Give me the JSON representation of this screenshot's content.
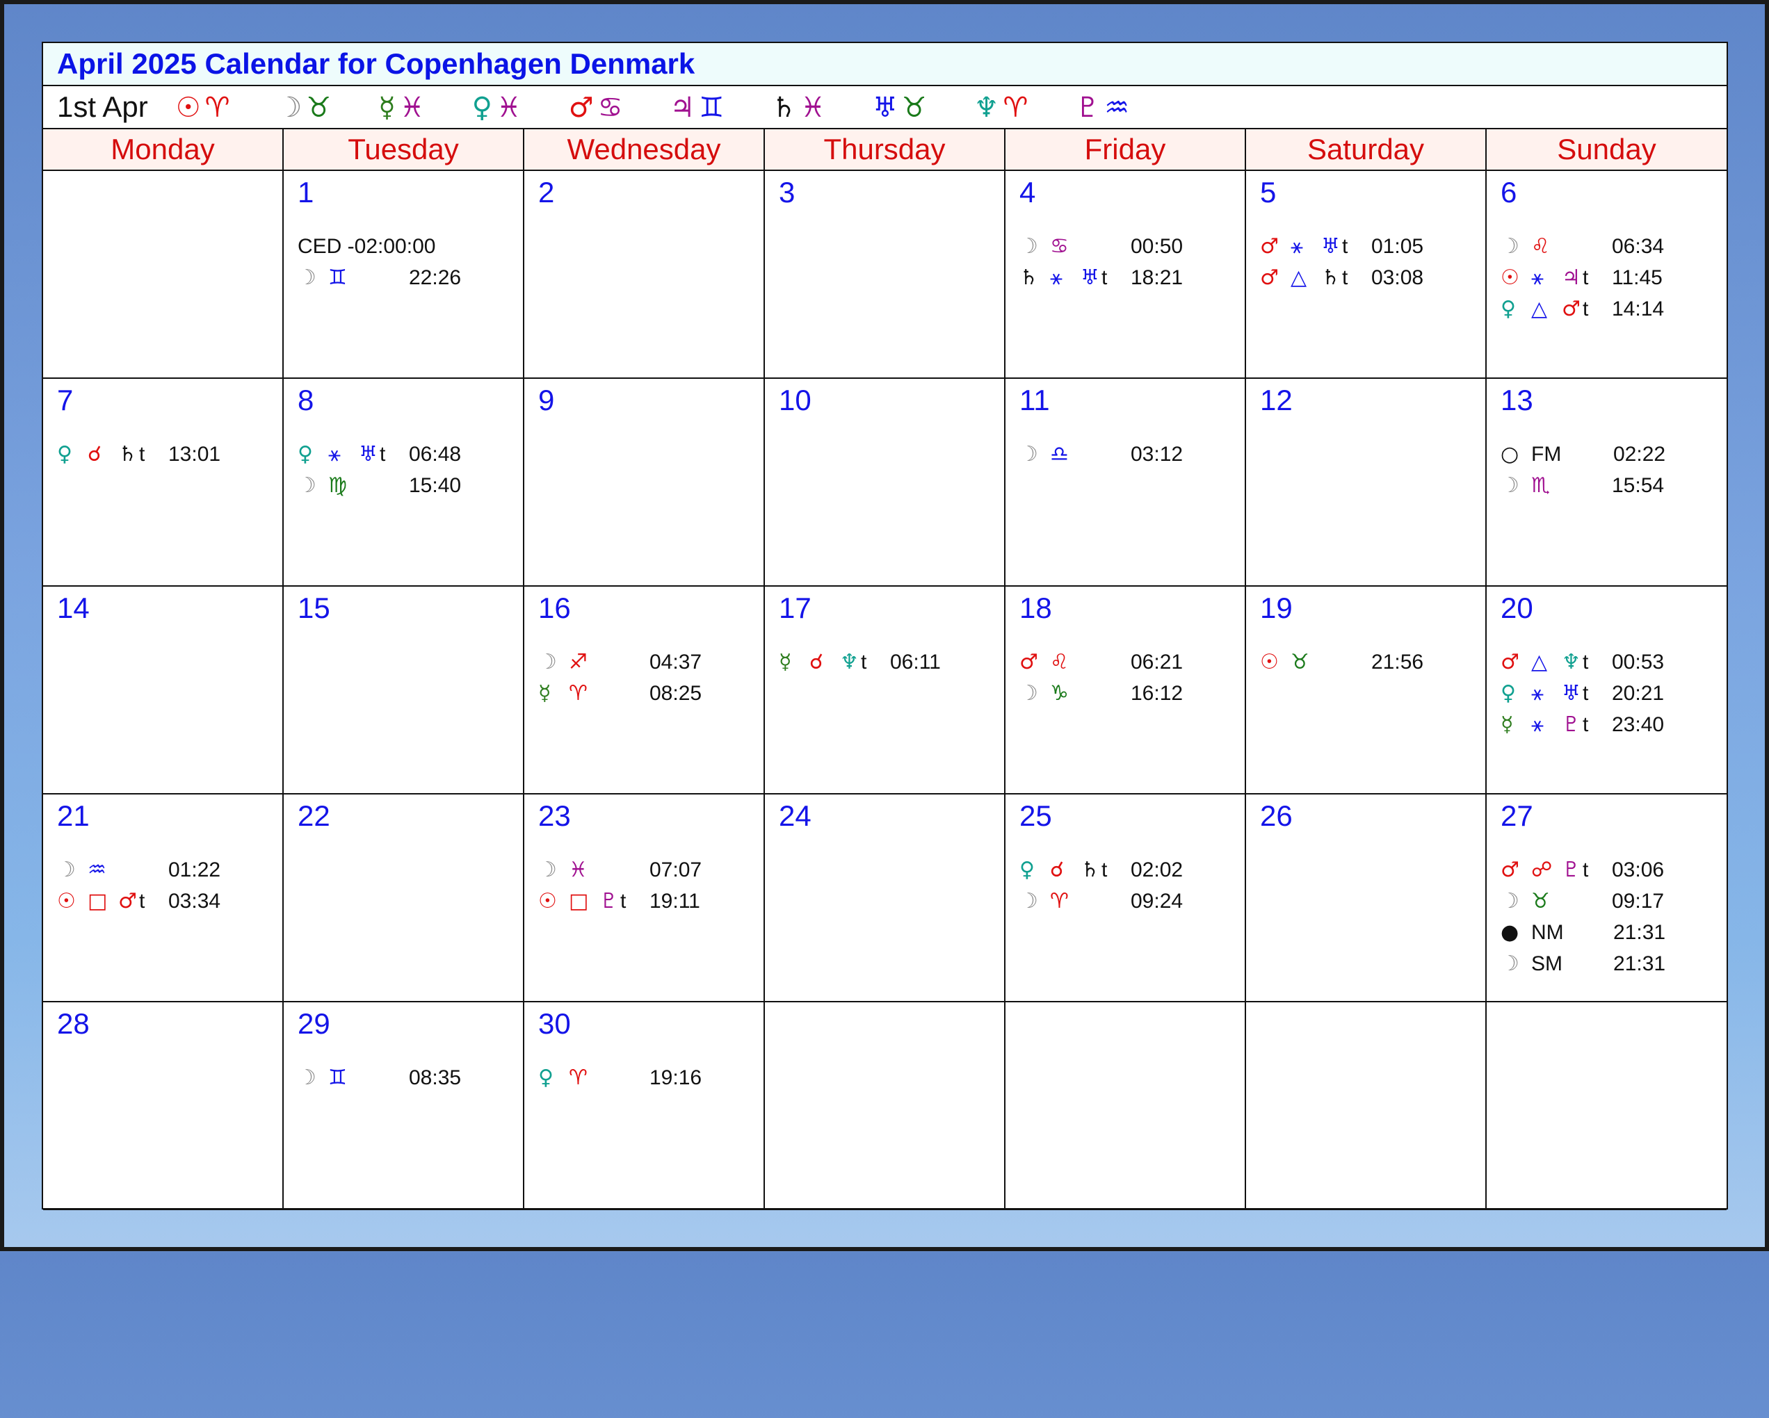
{
  "title": "April 2025 Calendar for Copenhagen Denmark",
  "planet_bar": {
    "date": "1st Apr",
    "items": [
      {
        "planet": "☉",
        "planet_color": "#e01010",
        "sign": "♈",
        "sign_color": "#e01010"
      },
      {
        "planet": "☽",
        "planet_color": "#888888",
        "sign": "♉",
        "sign_color": "#1a7a1a"
      },
      {
        "planet": "☿",
        "planet_color": "#2e7d1e",
        "sign": "♓",
        "sign_color": "#a01090"
      },
      {
        "planet": "♀",
        "planet_color": "#10a090",
        "sign": "♓",
        "sign_color": "#a01090"
      },
      {
        "planet": "♂",
        "planet_color": "#e01010",
        "sign": "♋",
        "sign_color": "#a01090"
      },
      {
        "planet": "♃",
        "planet_color": "#a01090",
        "sign": "♊",
        "sign_color": "#1414e8"
      },
      {
        "planet": "♄",
        "planet_color": "#111111",
        "sign": "♓",
        "sign_color": "#a01090"
      },
      {
        "planet": "♅",
        "planet_color": "#1414e8",
        "sign": "♉",
        "sign_color": "#1a7a1a"
      },
      {
        "planet": "♆",
        "planet_color": "#10a090",
        "sign": "♈",
        "sign_color": "#e01010"
      },
      {
        "planet": "♇",
        "planet_color": "#a01090",
        "sign": "♒",
        "sign_color": "#1414e8"
      }
    ]
  },
  "weekdays": [
    "Monday",
    "Tuesday",
    "Wednesday",
    "Thursday",
    "Friday",
    "Saturday",
    "Sunday"
  ],
  "colors": {
    "sun": "#e01010",
    "moon": "#888888",
    "mercury": "#2e7d1e",
    "venus": "#10a090",
    "mars": "#e01010",
    "jupiter": "#a01090",
    "saturn": "#111111",
    "uranus": "#1414e8",
    "neptune": "#10a090",
    "pluto": "#a01090",
    "aspect": "#1414e8",
    "square": "#e01010"
  },
  "days": [
    {
      "n": "",
      "events": []
    },
    {
      "n": "1",
      "events": [
        {
          "text": "CED -02:00:00"
        },
        {
          "g1": "☽",
          "c1": "#888888",
          "g2": "♊",
          "c2": "#1414e8",
          "time": "22:26"
        }
      ]
    },
    {
      "n": "2",
      "events": []
    },
    {
      "n": "3",
      "events": []
    },
    {
      "n": "4",
      "events": [
        {
          "g1": "☽",
          "c1": "#888888",
          "g2": "♋",
          "c2": "#a01090",
          "time": "00:50"
        },
        {
          "g1": "♄",
          "c1": "#111111",
          "g2": "⚹",
          "c2": "#1414e8",
          "g3": "♅",
          "c3": "#1414e8",
          "t": "t",
          "time": "18:21"
        }
      ]
    },
    {
      "n": "5",
      "events": [
        {
          "g1": "♂",
          "c1": "#e01010",
          "g2": "⚹",
          "c2": "#1414e8",
          "g3": "♅",
          "c3": "#1414e8",
          "t": "t",
          "time": "01:05"
        },
        {
          "g1": "♂",
          "c1": "#e01010",
          "g2": "△",
          "c2": "#1414e8",
          "g3": "♄",
          "c3": "#111111",
          "t": "t",
          "time": "03:08"
        }
      ]
    },
    {
      "n": "6",
      "events": [
        {
          "g1": "☽",
          "c1": "#888888",
          "g2": "♌",
          "c2": "#e01010",
          "time": "06:34"
        },
        {
          "g1": "☉",
          "c1": "#e01010",
          "g2": "⚹",
          "c2": "#1414e8",
          "g3": "♃",
          "c3": "#a01090",
          "t": "t",
          "time": "11:45"
        },
        {
          "g1": "♀",
          "c1": "#10a090",
          "g2": "△",
          "c2": "#1414e8",
          "g3": "♂",
          "c3": "#e01010",
          "t": "t",
          "time": "14:14"
        }
      ]
    },
    {
      "n": "7",
      "events": [
        {
          "g1": "♀",
          "c1": "#10a090",
          "g2": "☌",
          "c2": "#e01010",
          "g3": "♄",
          "c3": "#111111",
          "t": "t",
          "time": "13:01"
        }
      ]
    },
    {
      "n": "8",
      "events": [
        {
          "g1": "♀",
          "c1": "#10a090",
          "g2": "⚹",
          "c2": "#1414e8",
          "g3": "♅",
          "c3": "#1414e8",
          "t": "t",
          "time": "06:48"
        },
        {
          "g1": "☽",
          "c1": "#888888",
          "g2": "♍",
          "c2": "#1a7a1a",
          "time": "15:40"
        }
      ]
    },
    {
      "n": "9",
      "events": []
    },
    {
      "n": "10",
      "events": []
    },
    {
      "n": "11",
      "events": [
        {
          "g1": "☽",
          "c1": "#888888",
          "g2": "♎",
          "c2": "#1414e8",
          "time": "03:12"
        }
      ]
    },
    {
      "n": "12",
      "events": []
    },
    {
      "n": "13",
      "events": [
        {
          "g1": "○",
          "c1": "#111111",
          "label": "FM",
          "time": "02:22"
        },
        {
          "g1": "☽",
          "c1": "#888888",
          "g2": "♏",
          "c2": "#a01090",
          "time": "15:54"
        }
      ]
    },
    {
      "n": "14",
      "events": []
    },
    {
      "n": "15",
      "events": []
    },
    {
      "n": "16",
      "events": [
        {
          "g1": "☽",
          "c1": "#888888",
          "g2": "♐",
          "c2": "#e01010",
          "time": "04:37"
        },
        {
          "g1": "☿",
          "c1": "#2e7d1e",
          "g2": "♈",
          "c2": "#e01010",
          "time": "08:25"
        }
      ]
    },
    {
      "n": "17",
      "events": [
        {
          "g1": "☿",
          "c1": "#2e7d1e",
          "g2": "☌",
          "c2": "#e01010",
          "g3": "♆",
          "c3": "#10a090",
          "t": "t",
          "time": "06:11"
        }
      ]
    },
    {
      "n": "18",
      "events": [
        {
          "g1": "♂",
          "c1": "#e01010",
          "g2": "♌",
          "c2": "#e01010",
          "time": "06:21"
        },
        {
          "g1": "☽",
          "c1": "#888888",
          "g2": "♑",
          "c2": "#1a7a1a",
          "time": "16:12"
        }
      ]
    },
    {
      "n": "19",
      "events": [
        {
          "g1": "☉",
          "c1": "#e01010",
          "g2": "♉",
          "c2": "#1a7a1a",
          "time": "21:56"
        }
      ]
    },
    {
      "n": "20",
      "events": [
        {
          "g1": "♂",
          "c1": "#e01010",
          "g2": "△",
          "c2": "#1414e8",
          "g3": "♆",
          "c3": "#10a090",
          "t": "t",
          "time": "00:53"
        },
        {
          "g1": "♀",
          "c1": "#10a090",
          "g2": "⚹",
          "c2": "#1414e8",
          "g3": "♅",
          "c3": "#1414e8",
          "t": "t",
          "time": "20:21"
        },
        {
          "g1": "☿",
          "c1": "#2e7d1e",
          "g2": "⚹",
          "c2": "#1414e8",
          "g3": "♇",
          "c3": "#a01090",
          "t": "t",
          "time": "23:40"
        }
      ]
    },
    {
      "n": "21",
      "events": [
        {
          "g1": "☽",
          "c1": "#888888",
          "g2": "♒",
          "c2": "#1414e8",
          "time": "01:22"
        },
        {
          "g1": "☉",
          "c1": "#e01010",
          "g2": "□",
          "c2": "#e01010",
          "g3": "♂",
          "c3": "#e01010",
          "t": "t",
          "time": "03:34"
        }
      ]
    },
    {
      "n": "22",
      "events": []
    },
    {
      "n": "23",
      "events": [
        {
          "g1": "☽",
          "c1": "#888888",
          "g2": "♓",
          "c2": "#a01090",
          "time": "07:07"
        },
        {
          "g1": "☉",
          "c1": "#e01010",
          "g2": "□",
          "c2": "#e01010",
          "g3": "♇",
          "c3": "#a01090",
          "t": "t",
          "time": "19:11"
        }
      ]
    },
    {
      "n": "24",
      "events": []
    },
    {
      "n": "25",
      "events": [
        {
          "g1": "♀",
          "c1": "#10a090",
          "g2": "☌",
          "c2": "#e01010",
          "g3": "♄",
          "c3": "#111111",
          "t": "t",
          "time": "02:02"
        },
        {
          "g1": "☽",
          "c1": "#888888",
          "g2": "♈",
          "c2": "#e01010",
          "time": "09:24"
        }
      ]
    },
    {
      "n": "26",
      "events": []
    },
    {
      "n": "27",
      "events": [
        {
          "g1": "♂",
          "c1": "#e01010",
          "g2": "☍",
          "c2": "#e01010",
          "g3": "♇",
          "c3": "#a01090",
          "t": "t",
          "time": "03:06"
        },
        {
          "g1": "☽",
          "c1": "#888888",
          "g2": "♉",
          "c2": "#1a7a1a",
          "time": "09:17"
        },
        {
          "g1": "●",
          "c1": "#111111",
          "label": "NM",
          "time": "21:31"
        },
        {
          "g1": "☽",
          "c1": "#888888",
          "label": "SM",
          "time": "21:31"
        }
      ]
    },
    {
      "n": "28",
      "events": []
    },
    {
      "n": "29",
      "events": [
        {
          "g1": "☽",
          "c1": "#888888",
          "g2": "♊",
          "c2": "#1414e8",
          "time": "08:35"
        }
      ]
    },
    {
      "n": "30",
      "events": [
        {
          "g1": "♀",
          "c1": "#10a090",
          "g2": "♈",
          "c2": "#e01010",
          "time": "19:16"
        }
      ]
    },
    {
      "n": "",
      "events": []
    },
    {
      "n": "",
      "events": []
    },
    {
      "n": "",
      "events": []
    },
    {
      "n": "",
      "events": []
    }
  ]
}
